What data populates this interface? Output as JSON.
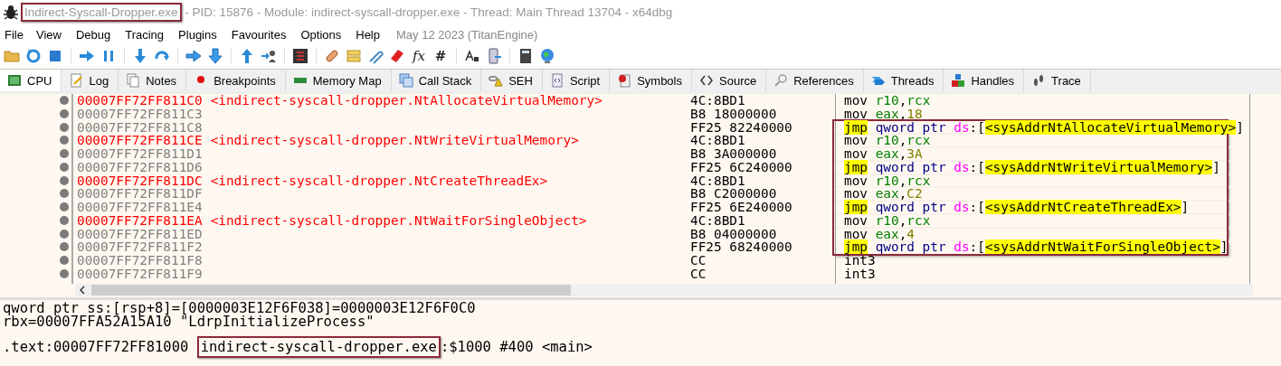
{
  "window": {
    "title_parts": [
      {
        "text": "Indirect-Syscall-Dropper.exe",
        "boxed": true
      },
      {
        "text": " - PID: 15876 - Module: indirect-syscall-dropper.exe - Thread: Main Thread 13704 - x64dbg",
        "boxed": false
      }
    ]
  },
  "menu": {
    "items": [
      "File",
      "View",
      "Debug",
      "Tracing",
      "Plugins",
      "Favourites",
      "Options",
      "Help"
    ],
    "build": "May 12 2023 (TitanEngine)"
  },
  "toolbar": {
    "glyphs": [
      "fx",
      "#"
    ]
  },
  "tabs": [
    {
      "label": "CPU",
      "selected": true
    },
    {
      "label": "Log",
      "selected": false
    },
    {
      "label": "Notes",
      "selected": false
    },
    {
      "label": "Breakpoints",
      "selected": false
    },
    {
      "label": "Memory Map",
      "selected": false
    },
    {
      "label": "Call Stack",
      "selected": false
    },
    {
      "label": "SEH",
      "selected": false
    },
    {
      "label": "Script",
      "selected": false
    },
    {
      "label": "Symbols",
      "selected": false
    },
    {
      "label": "Source",
      "selected": false
    },
    {
      "label": "References",
      "selected": false
    },
    {
      "label": "Threads",
      "selected": false
    },
    {
      "label": "Handles",
      "selected": false
    },
    {
      "label": "Trace",
      "selected": false
    }
  ],
  "disassembly": {
    "rows": [
      {
        "address": "00007FF72FF811C0",
        "label": "<indirect-syscall-dropper.NtAllocateVirtualMemory>",
        "bytes": "4C:8BD1",
        "boxed": false,
        "tokens": [
          {
            "kind": "op",
            "text": "mov "
          },
          {
            "kind": "reg",
            "text": "r10"
          },
          {
            "kind": "punct",
            "text": ","
          },
          {
            "kind": "reg",
            "text": "rcx"
          }
        ]
      },
      {
        "address": "00007FF72FF811C3",
        "bytes": "B8 18000000",
        "boxed": false,
        "tokens": [
          {
            "kind": "op",
            "text": "mov "
          },
          {
            "kind": "reg",
            "text": "eax"
          },
          {
            "kind": "punct",
            "text": ","
          },
          {
            "kind": "imm",
            "text": "18"
          }
        ]
      },
      {
        "address": "00007FF72FF811C8",
        "bytes": "FF25 82240000",
        "boxed": true,
        "tokens": [
          {
            "kind": "jump",
            "text": "jmp"
          },
          {
            "kind": "size",
            "text": "qword ptr "
          },
          {
            "kind": "seg",
            "text": "ds"
          },
          {
            "kind": "punct",
            "text": ":["
          },
          {
            "kind": "sym",
            "text": "<sysAddrNtAllocateVirtualMemory>"
          },
          {
            "kind": "punct",
            "text": "]"
          }
        ]
      },
      {
        "address": "00007FF72FF811CE",
        "label": "<indirect-syscall-dropper.NtWriteVirtualMemory>",
        "bytes": "4C:8BD1",
        "boxed": true,
        "tokens": [
          {
            "kind": "op",
            "text": "mov "
          },
          {
            "kind": "reg",
            "text": "r10"
          },
          {
            "kind": "punct",
            "text": ","
          },
          {
            "kind": "reg",
            "text": "rcx"
          }
        ]
      },
      {
        "address": "00007FF72FF811D1",
        "bytes": "B8 3A000000",
        "boxed": true,
        "tokens": [
          {
            "kind": "op",
            "text": "mov "
          },
          {
            "kind": "reg",
            "text": "eax"
          },
          {
            "kind": "punct",
            "text": ","
          },
          {
            "kind": "imm",
            "text": "3A"
          }
        ]
      },
      {
        "address": "00007FF72FF811D6",
        "bytes": "FF25 6C240000",
        "boxed": true,
        "tokens": [
          {
            "kind": "jump",
            "text": "jmp"
          },
          {
            "kind": "size",
            "text": "qword ptr "
          },
          {
            "kind": "seg",
            "text": "ds"
          },
          {
            "kind": "punct",
            "text": ":["
          },
          {
            "kind": "sym",
            "text": "<sysAddrNtWriteVirtualMemory>"
          },
          {
            "kind": "punct",
            "text": "]"
          }
        ]
      },
      {
        "address": "00007FF72FF811DC",
        "label": "<indirect-syscall-dropper.NtCreateThreadEx>",
        "bytes": "4C:8BD1",
        "boxed": true,
        "tokens": [
          {
            "kind": "op",
            "text": "mov "
          },
          {
            "kind": "reg",
            "text": "r10"
          },
          {
            "kind": "punct",
            "text": ","
          },
          {
            "kind": "reg",
            "text": "rcx"
          }
        ]
      },
      {
        "address": "00007FF72FF811DF",
        "bytes": "B8 C2000000",
        "boxed": true,
        "tokens": [
          {
            "kind": "op",
            "text": "mov "
          },
          {
            "kind": "reg",
            "text": "eax"
          },
          {
            "kind": "punct",
            "text": ","
          },
          {
            "kind": "imm",
            "text": "C2"
          }
        ]
      },
      {
        "address": "00007FF72FF811E4",
        "bytes": "FF25 6E240000",
        "boxed": true,
        "tokens": [
          {
            "kind": "jump",
            "text": "jmp"
          },
          {
            "kind": "size",
            "text": "qword ptr "
          },
          {
            "kind": "seg",
            "text": "ds"
          },
          {
            "kind": "punct",
            "text": ":["
          },
          {
            "kind": "sym",
            "text": "<sysAddrNtCreateThreadEx>"
          },
          {
            "kind": "punct",
            "text": "]"
          }
        ]
      },
      {
        "address": "00007FF72FF811EA",
        "label": "<indirect-syscall-dropper.NtWaitForSingleObject>",
        "bytes": "4C:8BD1",
        "boxed": true,
        "tokens": [
          {
            "kind": "op",
            "text": "mov "
          },
          {
            "kind": "reg",
            "text": "r10"
          },
          {
            "kind": "punct",
            "text": ","
          },
          {
            "kind": "reg",
            "text": "rcx"
          }
        ]
      },
      {
        "address": "00007FF72FF811ED",
        "bytes": "B8 04000000",
        "boxed": true,
        "tokens": [
          {
            "kind": "op",
            "text": "mov "
          },
          {
            "kind": "reg",
            "text": "eax"
          },
          {
            "kind": "punct",
            "text": ","
          },
          {
            "kind": "imm",
            "text": "4"
          }
        ]
      },
      {
        "address": "00007FF72FF811F2",
        "bytes": "FF25 68240000",
        "boxed": true,
        "tokens": [
          {
            "kind": "jump",
            "text": "jmp"
          },
          {
            "kind": "size",
            "text": "qword ptr "
          },
          {
            "kind": "seg",
            "text": "ds"
          },
          {
            "kind": "punct",
            "text": ":["
          },
          {
            "kind": "sym",
            "text": "<sysAddrNtWaitForSingleObject>"
          },
          {
            "kind": "punct",
            "text": "]"
          }
        ]
      },
      {
        "address": "00007FF72FF811F8",
        "bytes": "CC",
        "boxed": false,
        "tokens": [
          {
            "kind": "op",
            "text": "int3"
          }
        ]
      },
      {
        "address": "00007FF72FF811F9",
        "bytes": "CC",
        "boxed": false,
        "tokens": [
          {
            "kind": "op",
            "text": "int3"
          }
        ]
      }
    ]
  },
  "info": {
    "lines": [
      "qword ptr ss:[rsp+8]=[0000003E12F6F038]=0000003E12F6F0C0",
      "rbx=00007FFA52A15A10 \"LdrpInitializeProcess\""
    ],
    "location_parts": [
      {
        "text": ".text:00007FF72FF81000 ",
        "boxed": false
      },
      {
        "text": "indirect-syscall-dropper.exe",
        "boxed": true
      },
      {
        "text": ":$1000 #400 <main>",
        "boxed": false
      }
    ]
  }
}
